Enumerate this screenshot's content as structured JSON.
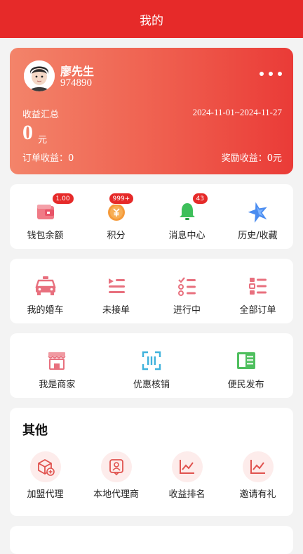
{
  "header": {
    "title": "我的"
  },
  "profile": {
    "name": "廖先生",
    "id": "974890",
    "summary_label": "收益汇总",
    "date_range": "2024-11-01~2024-11-27",
    "income_value": "0",
    "income_unit": "元",
    "order_income": "订单收益：0",
    "reward_income": "奖励收益：0元"
  },
  "wallet_row": [
    {
      "label": "钱包余额",
      "icon": "wallet-icon",
      "badge": "1.00"
    },
    {
      "label": "积分",
      "icon": "points-coin-icon",
      "badge": "999+"
    },
    {
      "label": "消息中心",
      "icon": "bell-icon",
      "badge": "43"
    },
    {
      "label": "历史/收藏",
      "icon": "star-icon",
      "badge": ""
    }
  ],
  "order_row": [
    {
      "label": "我的婚车",
      "icon": "car-icon"
    },
    {
      "label": "未接单",
      "icon": "play-list-icon"
    },
    {
      "label": "进行中",
      "icon": "checklist-icon"
    },
    {
      "label": "全部订单",
      "icon": "order-list-icon"
    }
  ],
  "service_row": [
    {
      "label": "我是商家",
      "icon": "shop-icon"
    },
    {
      "label": "优惠核销",
      "icon": "scan-icon"
    },
    {
      "label": "便民发布",
      "icon": "publish-icon"
    }
  ],
  "other": {
    "title": "其他",
    "items": [
      {
        "label": "加盟代理",
        "icon": "box-plus-icon"
      },
      {
        "label": "本地代理商",
        "icon": "agent-badge-icon"
      },
      {
        "label": "收益排名",
        "icon": "trend-chart-icon"
      },
      {
        "label": "邀请有礼",
        "icon": "trend-chart-icon"
      }
    ]
  },
  "colors": {
    "brand": "#e62a29",
    "card_gradient_start": "#f3846a",
    "card_gradient_end": "#ea3b37"
  }
}
